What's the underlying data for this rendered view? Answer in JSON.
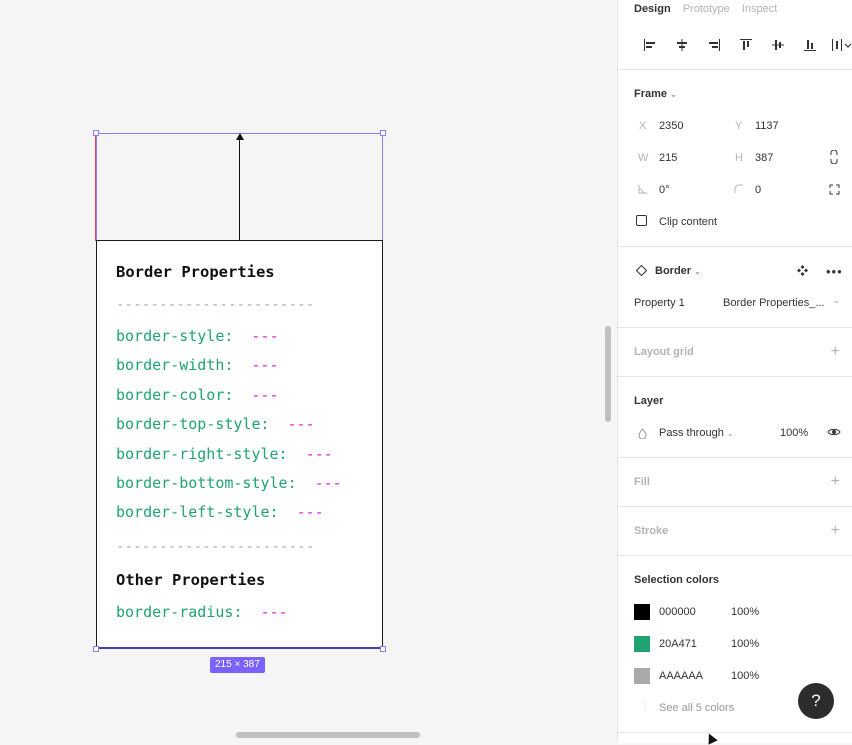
{
  "canvas": {
    "card": {
      "title1": "Border Properties",
      "divider": "-----------------------",
      "properties": [
        {
          "name": "border-style:",
          "value": "---"
        },
        {
          "name": "border-width:",
          "value": "---"
        },
        {
          "name": "border-color:",
          "value": "---"
        },
        {
          "name": "border-top-style:",
          "value": "---"
        },
        {
          "name": "border-right-style:",
          "value": "---"
        },
        {
          "name": "border-bottom-style:",
          "value": "---"
        },
        {
          "name": "border-left-style:",
          "value": "---"
        }
      ],
      "title2": "Other Properties",
      "other": {
        "name": "border-radius:",
        "value": "---"
      }
    },
    "dimension_badge": "215 × 387"
  },
  "panel": {
    "tabs": [
      "Design",
      "Prototype",
      "Inspect"
    ],
    "frame": {
      "title": "Frame",
      "x_label": "X",
      "x": "2350",
      "y_label": "Y",
      "y": "1137",
      "w_label": "W",
      "w": "215",
      "h_label": "H",
      "h": "387",
      "rotation": "0°",
      "radius": "0",
      "clip_content": "Clip content"
    },
    "component": {
      "name": "Border",
      "property_label": "Property 1",
      "property_value": "Border Properties_..."
    },
    "layout_grid": "Layout grid",
    "layer": {
      "title": "Layer",
      "blend": "Pass through",
      "opacity": "100%"
    },
    "fill": "Fill",
    "stroke": "Stroke",
    "selection_colors": {
      "title": "Selection colors",
      "colors": [
        {
          "hex": "000000",
          "opacity": "100%",
          "swatch": "#000000"
        },
        {
          "hex": "20A471",
          "opacity": "100%",
          "swatch": "#20A471"
        },
        {
          "hex": "AAAAAA",
          "opacity": "100%",
          "swatch": "#AAAAAA"
        }
      ],
      "see_all": "See all 5 colors"
    },
    "help": "?"
  }
}
